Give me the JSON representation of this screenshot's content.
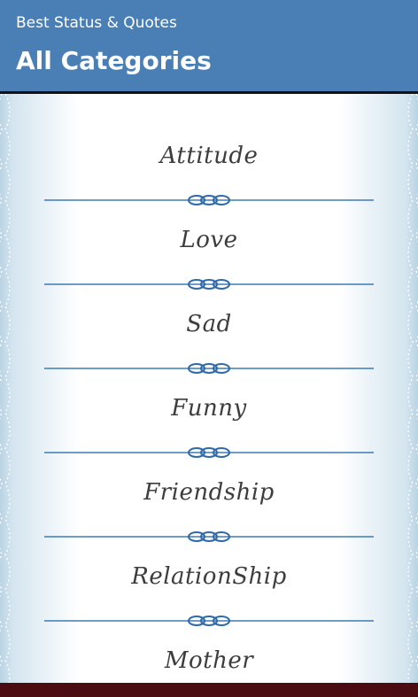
{
  "header": {
    "app_name": "Best Status & Quotes",
    "title": "All Categories"
  },
  "categories": [
    {
      "label": "Attitude"
    },
    {
      "label": "Love"
    },
    {
      "label": "Sad"
    },
    {
      "label": "Funny"
    },
    {
      "label": "Friendship"
    },
    {
      "label": "RelationShip"
    },
    {
      "label": "Mother"
    }
  ],
  "colors": {
    "header_bg": "#4a7fb5",
    "divider": "#3f7bb5",
    "footer_bg": "#4a0c10"
  },
  "icons": {
    "divider": "ornamental-knot-divider",
    "border": "dotted-scallop-border"
  }
}
